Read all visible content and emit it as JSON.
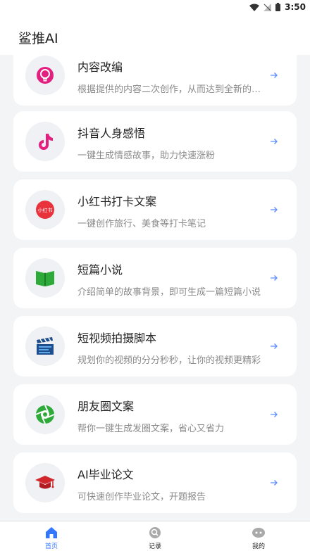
{
  "status_bar": {
    "time": "3:50"
  },
  "header": {
    "title": "鲨推AI"
  },
  "cards": [
    {
      "title": "内容改编",
      "desc": "根据提供的内容二次创作，从而达到全新的内容"
    },
    {
      "title": "抖音人身感悟",
      "desc": "一键生成情感故事，助力快速涨粉"
    },
    {
      "title": "小红书打卡文案",
      "desc": "一键创作旅行、美食等打卡笔记",
      "icon_text": "小红书"
    },
    {
      "title": "短篇小说",
      "desc": "介绍简单的故事背景，即可生成一篇短篇小说"
    },
    {
      "title": "短视频拍摄脚本",
      "desc": "规划你的视频的分分秒秒，让你的视频更精彩"
    },
    {
      "title": "朋友圈文案",
      "desc": "帮你一键生成发圈文案，省心又省力"
    },
    {
      "title": "AI毕业论文",
      "desc": "可快速创作毕业论文，开题报告"
    }
  ],
  "tabs": [
    {
      "label": "首页",
      "icon": "home-icon"
    },
    {
      "label": "记录",
      "icon": "record-icon"
    },
    {
      "label": "我的",
      "icon": "profile-icon"
    }
  ],
  "colors": {
    "accent": "#3377ff",
    "background": "#f3f4f6",
    "card": "#ffffff"
  }
}
